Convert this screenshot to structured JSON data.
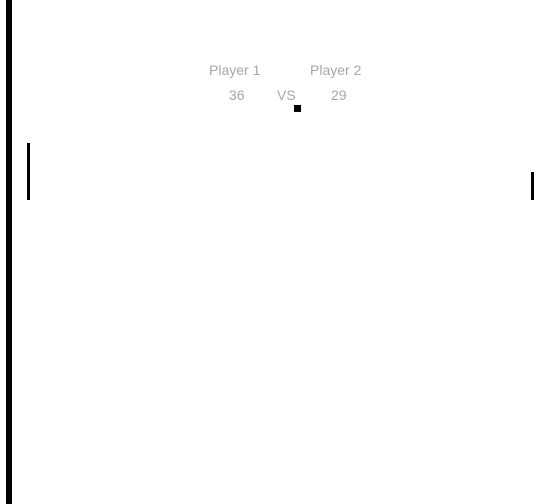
{
  "scoreboard": {
    "player1_name": "Player 1",
    "player2_name": "Player 2",
    "player1_score": "36",
    "player2_score": "29",
    "vs_label": "VS"
  },
  "colors": {
    "background": "#ffffff",
    "foreground": "#000000",
    "score_text": "#a6a6a6"
  }
}
